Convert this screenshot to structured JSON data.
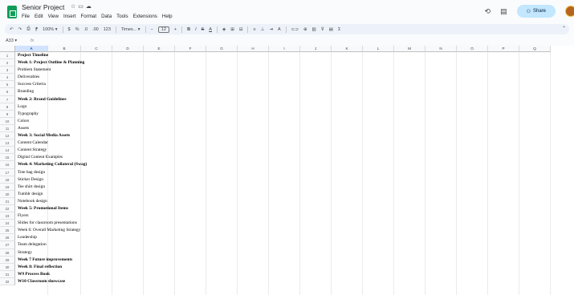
{
  "document": {
    "title": "Senior Project",
    "menu": [
      "File",
      "Edit",
      "View",
      "Insert",
      "Format",
      "Data",
      "Tools",
      "Extensions",
      "Help"
    ]
  },
  "header_actions": {
    "share_label": "Share",
    "history_icon": "history-icon",
    "comments_icon": "comments-icon"
  },
  "toolbar": {
    "undo": "↶",
    "redo": "↷",
    "print": "⎙",
    "paint_format": "⁋",
    "zoom": "100%",
    "currency": "$",
    "percent": "%",
    "decrease_decimals": ".0",
    "increase_decimals": ".00",
    "number_format": "123",
    "font_name": "Times...",
    "font_size_minus": "−",
    "font_size": "12",
    "font_size_plus": "+",
    "bold": "B",
    "italic": "I",
    "strikethrough": "S",
    "text_color": "A",
    "fill_color": "◈",
    "borders": "⊞",
    "merge": "⊟",
    "halign": "≡",
    "valign": "⊥",
    "wrap": "⇥",
    "rotate": "A",
    "link": "⊂⊃",
    "comment": "⊕",
    "chart": "▥",
    "filter": "⊽",
    "filter_views": "▤",
    "functions": "Σ",
    "collapse": "⌃"
  },
  "formula_bar": {
    "name_box": "A33",
    "fx": "fx",
    "content": ""
  },
  "columns": [
    "A",
    "B",
    "C",
    "D",
    "E",
    "F",
    "G",
    "H",
    "I",
    "J",
    "K",
    "L",
    "M",
    "N",
    "O",
    "P",
    "Q"
  ],
  "selected_column": "A",
  "row_colors": {
    "red": "#f4cccc",
    "orange": "#fce5cd",
    "yellow": "#fff2cc",
    "green": "#d9ead3",
    "teal": "#d0e0e3",
    "blue": "#c9daf8",
    "purple": "#d9d2e9",
    "pink": "#ead1dc"
  },
  "rows": [
    {
      "num": "1",
      "text": "Project Timeline",
      "bold": true,
      "color": "red"
    },
    {
      "num": "2",
      "text": "Week 1: Project Outline & Planning",
      "bold": true,
      "color": "red"
    },
    {
      "num": "3",
      "text": "Problem Statement",
      "bold": false,
      "color": "red"
    },
    {
      "num": "4",
      "text": "Deliverables",
      "bold": false,
      "color": "red"
    },
    {
      "num": "5",
      "text": "Success Criteria",
      "bold": false,
      "color": "red"
    },
    {
      "num": "6",
      "text": "Branding",
      "bold": false,
      "color": "red"
    },
    {
      "num": "7",
      "text": "Week 2: Brand Guidelines",
      "bold": true,
      "color": "orange"
    },
    {
      "num": "8",
      "text": "Logo",
      "bold": false,
      "color": "orange"
    },
    {
      "num": "9",
      "text": "Typography",
      "bold": false,
      "color": "orange"
    },
    {
      "num": "10",
      "text": "Colors",
      "bold": false,
      "color": "orange"
    },
    {
      "num": "11",
      "text": "Assets",
      "bold": false,
      "color": "orange"
    },
    {
      "num": "12",
      "text": "Week 3: Social Media Assets",
      "bold": true,
      "color": "yellow"
    },
    {
      "num": "13",
      "text": "Content Calendar",
      "bold": false,
      "color": "yellow"
    },
    {
      "num": "14",
      "text": "Content Strategy",
      "bold": false,
      "color": "yellow"
    },
    {
      "num": "15",
      "text": "Digital Content Examples",
      "bold": false,
      "color": "yellow"
    },
    {
      "num": "16",
      "text": "Week 4: Marketing Collateral (Swag)",
      "bold": true,
      "color": "green"
    },
    {
      "num": "17",
      "text": "Tote bag design",
      "bold": false,
      "color": "green"
    },
    {
      "num": "18",
      "text": "Sticker Design",
      "bold": false,
      "color": "green"
    },
    {
      "num": "19",
      "text": "Tee shirt design",
      "bold": false,
      "color": "green"
    },
    {
      "num": "20",
      "text": "Tumblr design",
      "bold": false,
      "color": "green"
    },
    {
      "num": "21",
      "text": "Notebook design",
      "bold": false,
      "color": "green"
    },
    {
      "num": "22",
      "text": "Week 5: Promotional Items",
      "bold": true,
      "color": "teal"
    },
    {
      "num": "23",
      "text": "Flyers",
      "bold": false,
      "color": "teal"
    },
    {
      "num": "24",
      "text": "Slides for classroom presentations",
      "bold": false,
      "color": "teal"
    },
    {
      "num": "25",
      "text": "Week 6: Overall Marketing Strategy",
      "bold": false,
      "color": "teal"
    },
    {
      "num": "26",
      "text": "Leadership",
      "bold": false,
      "color": "teal"
    },
    {
      "num": "27",
      "text": "Team delegation",
      "bold": false,
      "color": "teal"
    },
    {
      "num": "28",
      "text": "Strategy",
      "bold": false,
      "color": "teal"
    },
    {
      "num": "29",
      "text": "Week 7 Future improvements",
      "bold": true,
      "color": "blue"
    },
    {
      "num": "30",
      "text": "Week 8: Final reflection",
      "bold": true,
      "color": "blue"
    },
    {
      "num": "31",
      "text": "W9 Process Book",
      "bold": true,
      "color": "purple"
    },
    {
      "num": "32",
      "text": "W10 Classroom showcase",
      "bold": true,
      "color": "pink"
    }
  ]
}
